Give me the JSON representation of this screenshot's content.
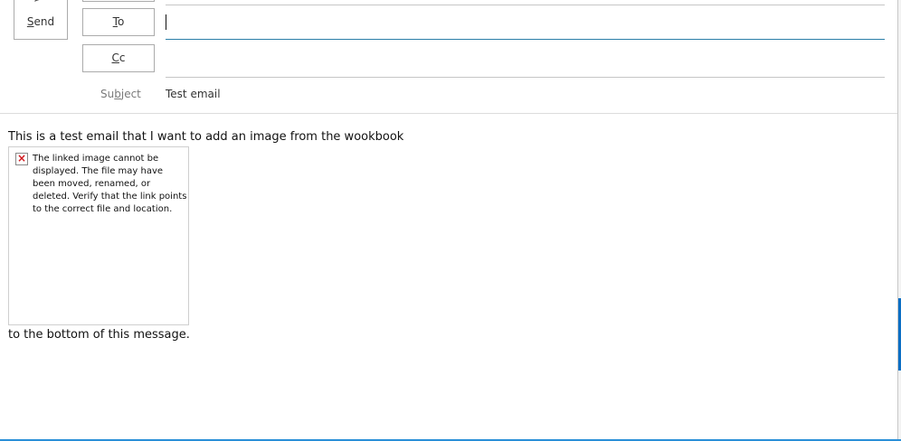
{
  "compose": {
    "send_label": "Send",
    "send_access_key": "S",
    "send_rest": "end",
    "to_label_key": "T",
    "to_label_rest": "o",
    "cc_label_key": "C",
    "cc_label_rest": "c",
    "to_value": "",
    "cc_value": "",
    "subject_label_pre": "Su",
    "subject_label_key": "b",
    "subject_label_post": "ject",
    "subject_value": "Test email"
  },
  "body": {
    "line1": "This is a test email that I want to add an image from the wookbook",
    "broken_image_text": "The linked image cannot be displayed.  The file may have been moved, renamed, or deleted. Verify that the link points to the correct file and location.",
    "line2": "to the bottom of this message."
  },
  "icons": {
    "send": "send-icon",
    "broken_image": "broken-image-icon"
  },
  "colors": {
    "accent": "#0a6ec4",
    "focus_underline": "#2b7fa8",
    "error_x": "#d0151b"
  }
}
